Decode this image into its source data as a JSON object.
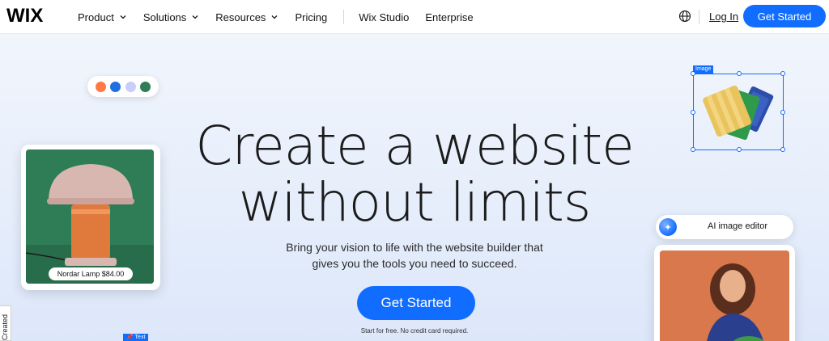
{
  "nav": {
    "logo": "WIX",
    "items": [
      {
        "label": "Product",
        "has_dropdown": true
      },
      {
        "label": "Solutions",
        "has_dropdown": true
      },
      {
        "label": "Resources",
        "has_dropdown": true
      },
      {
        "label": "Pricing",
        "has_dropdown": false
      }
    ],
    "items_right": [
      {
        "label": "Wix Studio"
      },
      {
        "label": "Enterprise"
      }
    ],
    "language_icon": "globe-icon",
    "login_label": "Log In",
    "cta_label": "Get Started"
  },
  "hero": {
    "headline_line1": "Create a website",
    "headline_line2": "without limits",
    "subhead_line1": "Bring your vision to life with the website builder that",
    "subhead_line2": "gives you the tools you need to succeed.",
    "cta_label": "Get Started",
    "note": "Start for free. No credit card required."
  },
  "swatches": [
    "#ff7a45",
    "#1f6fe0",
    "#c9cdfa",
    "#2e7d57"
  ],
  "lamp_card": {
    "price_label": "Nordar Lamp $84.00"
  },
  "image_widget": {
    "tag_label": "Image"
  },
  "ai_editor": {
    "label": "AI image editor",
    "icon": "sparkle-icon"
  },
  "side_tab": {
    "label": "Created"
  },
  "text_widget": {
    "tag_label": "Text"
  },
  "colors": {
    "brand_blue": "#116dff",
    "hero_bg": "#e6eefb"
  }
}
